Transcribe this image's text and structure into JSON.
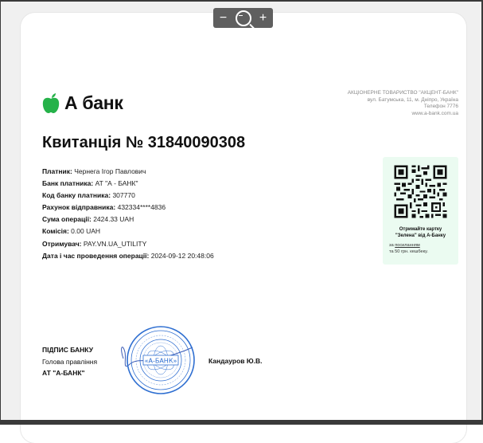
{
  "viewer": {
    "zoom_out_label": "−",
    "zoom_in_label": "+",
    "zoom_icon": "magnifier-minus-icon"
  },
  "logo": {
    "text": "А банк",
    "color": "#26b24a"
  },
  "company": {
    "name": "АКЦІОНЕРНЕ ТОВАРИСТВО \"АКЦЕНТ-БАНК\"",
    "address": "вул. Батумська, 11, м. Дніпро, Україна",
    "phone": "Телефон 7776",
    "site": "www.a-bank.com.ua"
  },
  "receipt": {
    "title": "Квитанція № 31840090308",
    "fields": [
      {
        "key": "Платник:",
        "value": "Чернега Ігор Павлович"
      },
      {
        "key": "Банк платника:",
        "value": "АТ \"А - БАНК\""
      },
      {
        "key": "Код банку платника:",
        "value": "307770"
      },
      {
        "key": "Рахунок відправника:",
        "value": "432334****4836"
      },
      {
        "key": "Сума операції:",
        "value": "2424.33 UAH"
      },
      {
        "key": "Комісія:",
        "value": "0.00 UAH"
      },
      {
        "key": "Отримувач:",
        "value": "PAY.VN.UA_UTILITY"
      },
      {
        "key": "Дата і час проведення операції:",
        "value": "2024-09-12 20:48:06"
      }
    ]
  },
  "promo": {
    "line1": "Отримайте картку",
    "line2": "\"Зелена\" від А-Банку",
    "small1_pre": "за ",
    "small1_link": "посиланням",
    "small2": "та 50 грн. кешбеку.",
    "bg": "#ebfbf1"
  },
  "signature": {
    "label": "ПІДПИС БАНКУ",
    "role": "Голова правління",
    "org": "АТ \"А-БАНК\"",
    "signer": "Кандауров Ю.В.",
    "stamp_text": "«А-БАНК»",
    "stamp_color": "#2f6fd1"
  }
}
